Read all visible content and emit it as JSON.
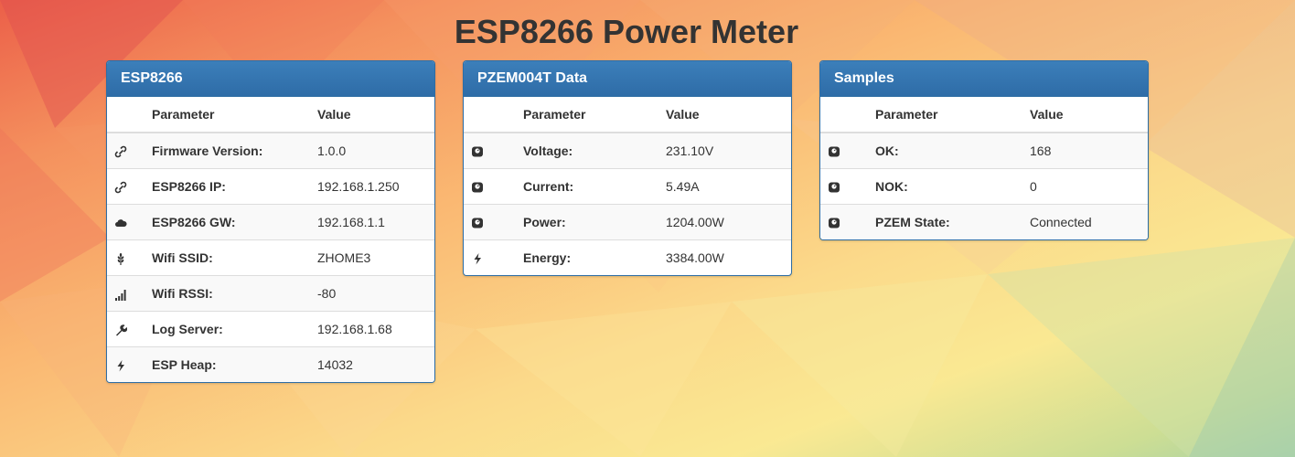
{
  "title": "ESP8266 Power Meter",
  "panels": [
    {
      "heading": "ESP8266",
      "col_param": "Parameter",
      "col_value": "Value",
      "rows": [
        {
          "icon": "link-icon",
          "param": "Firmware Version:",
          "value": "1.0.0"
        },
        {
          "icon": "link-icon",
          "param": "ESP8266 IP:",
          "value": "192.168.1.250"
        },
        {
          "icon": "cloud-icon",
          "param": "ESP8266 GW:",
          "value": "192.168.1.1"
        },
        {
          "icon": "wheat-icon",
          "param": "Wifi SSID:",
          "value": "ZHOME3"
        },
        {
          "icon": "signal-icon",
          "param": "Wifi RSSI:",
          "value": "-80"
        },
        {
          "icon": "wrench-icon",
          "param": "Log Server:",
          "value": "192.168.1.68"
        },
        {
          "icon": "flash-icon",
          "param": "ESP Heap:",
          "value": "14032"
        }
      ]
    },
    {
      "heading": "PZEM004T Data",
      "col_param": "Parameter",
      "col_value": "Value",
      "rows": [
        {
          "icon": "meter-icon",
          "param": "Voltage:",
          "value": "231.10V"
        },
        {
          "icon": "meter-icon",
          "param": "Current:",
          "value": "5.49A"
        },
        {
          "icon": "meter-icon",
          "param": "Power:",
          "value": "1204.00W"
        },
        {
          "icon": "flash-icon",
          "param": "Energy:",
          "value": "3384.00W"
        }
      ]
    },
    {
      "heading": "Samples",
      "col_param": "Parameter",
      "col_value": "Value",
      "rows": [
        {
          "icon": "meter-icon",
          "param": "OK:",
          "value": "168"
        },
        {
          "icon": "meter-icon",
          "param": "NOK:",
          "value": "0"
        },
        {
          "icon": "meter-icon",
          "param": "PZEM State:",
          "value": "Connected"
        }
      ]
    }
  ]
}
